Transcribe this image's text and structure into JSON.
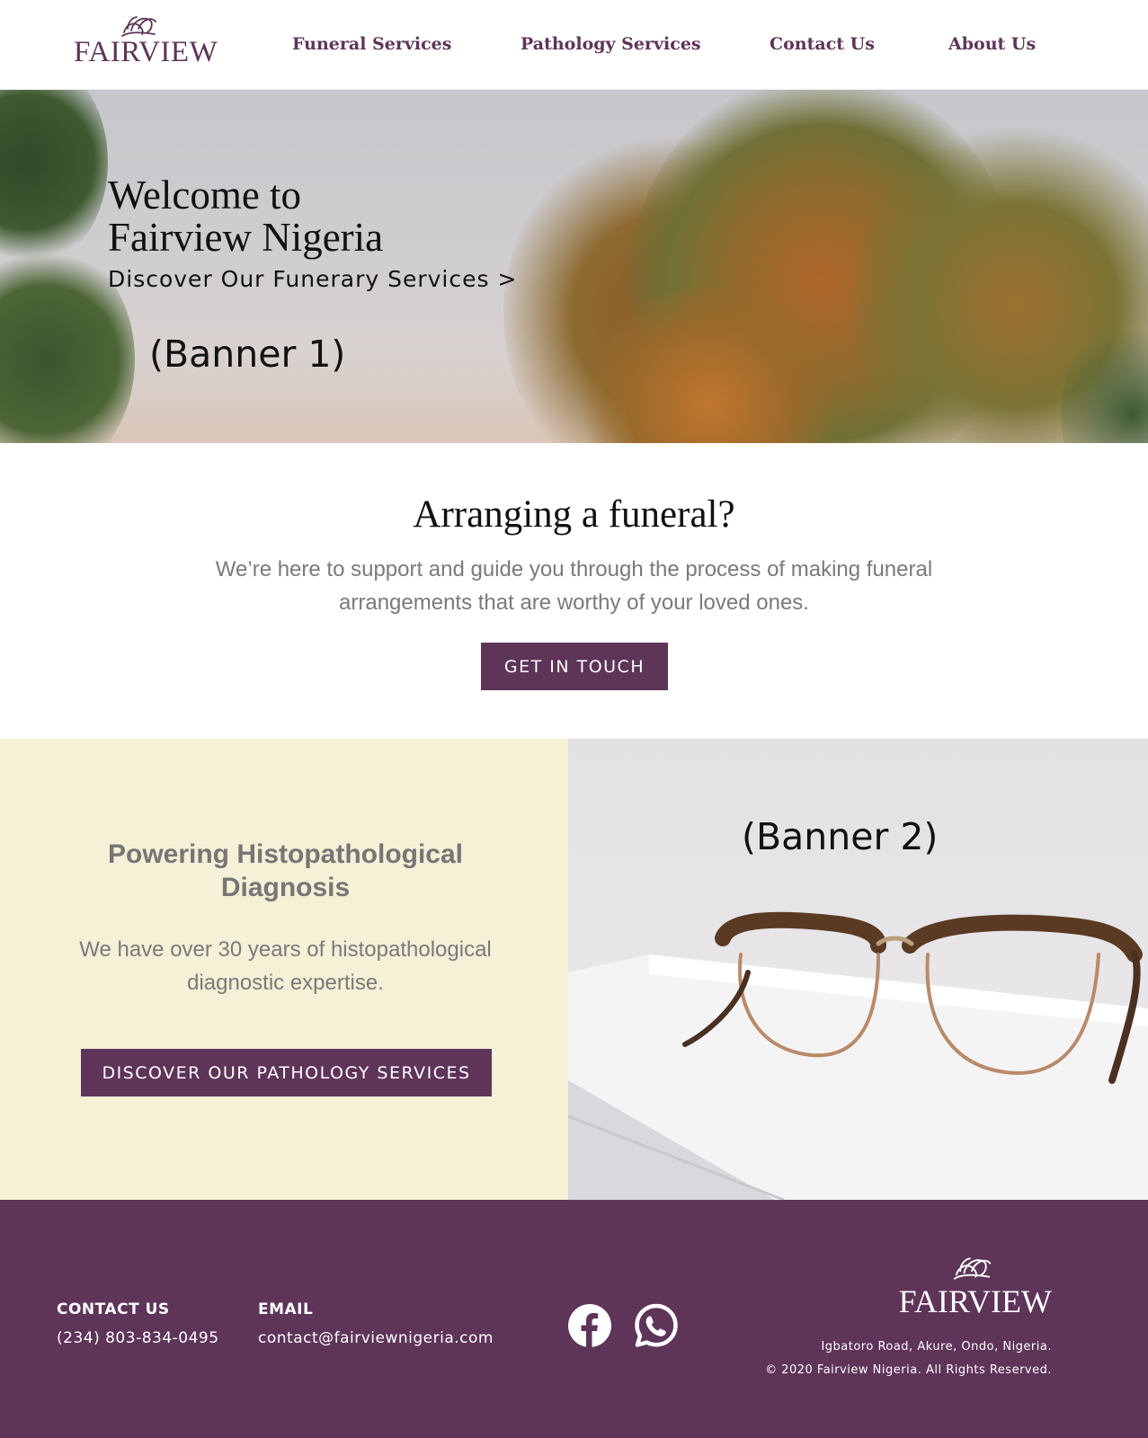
{
  "brand": {
    "name": "FAIRVIEW",
    "color": "#5e3459"
  },
  "nav": {
    "items": [
      {
        "label": "Funeral Services"
      },
      {
        "label": "Pathology Services"
      },
      {
        "label": "Contact Us"
      },
      {
        "label": "About Us"
      }
    ]
  },
  "hero": {
    "title_line1": "Welcome to",
    "title_line2": "Fairview Nigeria",
    "link": "Discover Our Funerary Services >",
    "banner_label": "(Banner 1)"
  },
  "funeral": {
    "title": "Arranging a funeral?",
    "text": "We’re here to support and guide you through the process of making funeral arrangements that are worthy of your loved ones.",
    "button": "GET IN TOUCH"
  },
  "pathology": {
    "title": "Powering Histopathological Diagnosis",
    "text": "We have over 30 years of histopathological diagnostic expertise.",
    "button": "DISCOVER OUR PATHOLOGY SERVICES",
    "banner_label": "(Banner 2)",
    "background": "#f5f0d6"
  },
  "footer": {
    "contact_heading": "CONTACT US",
    "phone": "(234) 803-834-0495",
    "email_heading": "EMAIL",
    "email": "contact@fairviewnigeria.com",
    "social": [
      "facebook-icon",
      "whatsapp-icon"
    ],
    "logo_text": "FAIRVIEW",
    "address": "Igbatoro Road, Akure, Ondo, Nigeria.",
    "copyright": "© 2020 Fairview Nigeria. All Rights Reserved."
  }
}
